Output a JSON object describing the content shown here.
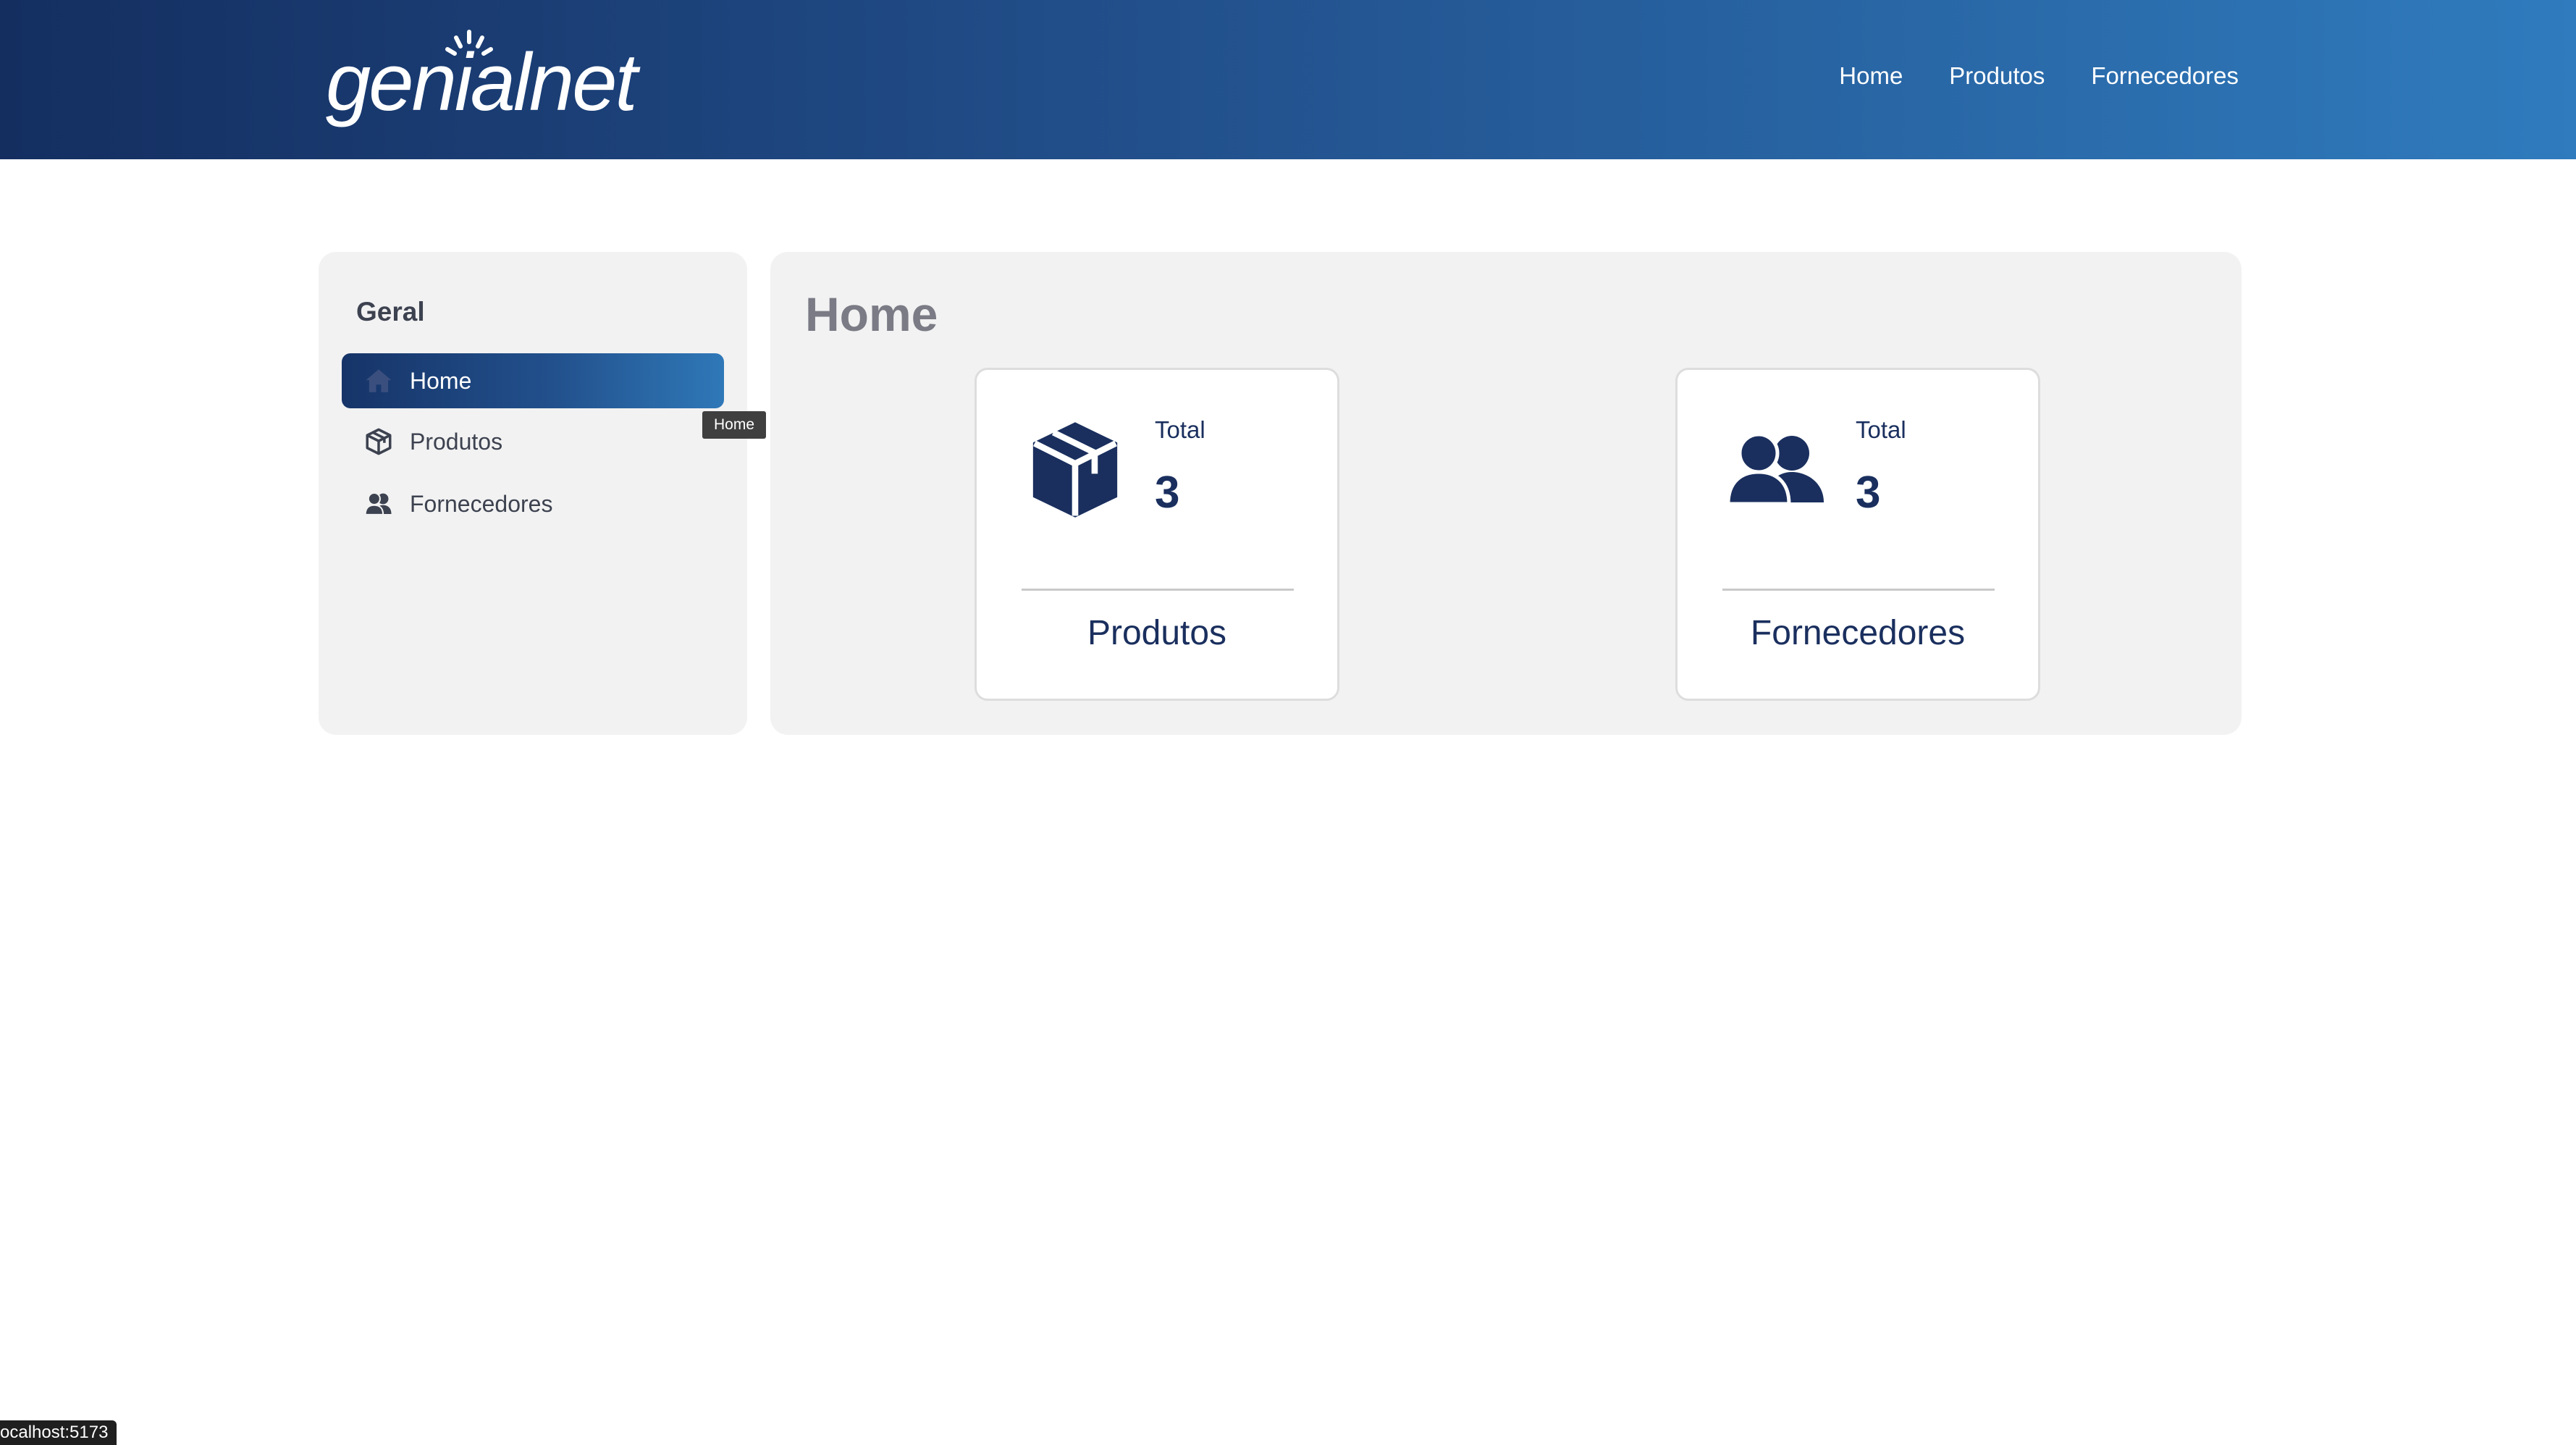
{
  "header": {
    "logo_text": "genialnet",
    "nav": [
      "Home",
      "Produtos",
      "Fornecedores"
    ]
  },
  "sidebar": {
    "heading": "Geral",
    "items": [
      {
        "label": "Home",
        "icon": "home-icon",
        "active": true
      },
      {
        "label": "Produtos",
        "icon": "box-icon",
        "active": false
      },
      {
        "label": "Fornecedores",
        "icon": "users-icon",
        "active": false
      }
    ],
    "tooltip": "Home"
  },
  "main": {
    "title": "Home",
    "cards": [
      {
        "icon": "box-icon",
        "total_label": "Total",
        "total_value": "3",
        "label": "Produtos"
      },
      {
        "icon": "users-icon",
        "total_label": "Total",
        "total_value": "3",
        "label": "Fornecedores"
      }
    ]
  },
  "status_bar": {
    "url": "ocalhost:5173"
  },
  "colors": {
    "header_start": "#142e60",
    "header_end": "#2f7bbd",
    "accent_dark": "#1a2f5e",
    "panel_bg": "#f2f2f2"
  }
}
